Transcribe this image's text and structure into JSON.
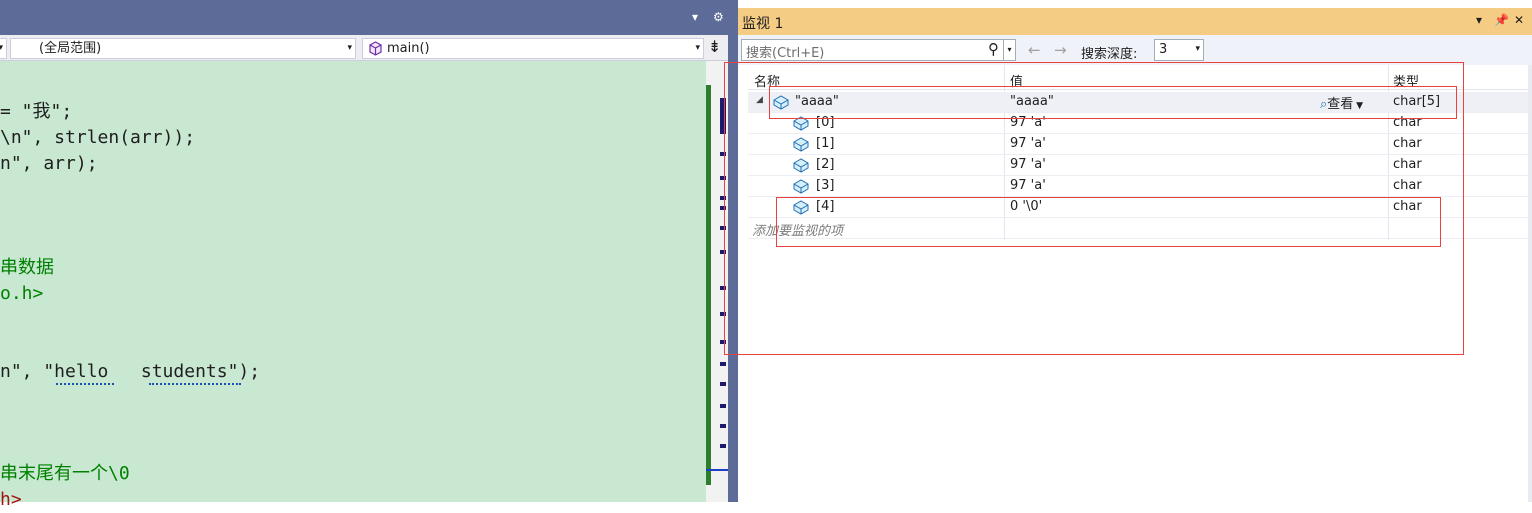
{
  "editor": {
    "nav": {
      "scope_combo": "(全局范围)",
      "function_combo": "main()"
    },
    "code_lines": [
      {
        "text": "= \"我\";",
        "style": "c-default"
      },
      {
        "text": "\\n\", strlen(arr));",
        "style": "c-default"
      },
      {
        "text": "n\", arr);",
        "style": "c-default"
      },
      {
        "text": "",
        "style": "c-default"
      },
      {
        "text": "",
        "style": "c-default"
      },
      {
        "text": "串数据",
        "style": "c-comment"
      },
      {
        "text": "o.h>",
        "style": "c-comment"
      },
      {
        "text": "",
        "style": "c-default"
      },
      {
        "text": "",
        "style": "c-default"
      },
      {
        "text": "n\", \"hello   students\");",
        "style": "c-default"
      },
      {
        "text": "",
        "style": "c-default"
      },
      {
        "text": "",
        "style": "c-default"
      },
      {
        "text": "串末尾有一个\\0",
        "style": "c-comment"
      },
      {
        "text": "h>",
        "style": "c-str"
      }
    ]
  },
  "watch": {
    "title": "监视 1",
    "search_placeholder": "搜索(Ctrl+E)",
    "depth_label": "搜索深度:",
    "depth_value": "3",
    "columns": {
      "name": "名称",
      "value": "值",
      "type": "类型"
    },
    "root": {
      "name": "\"aaaa\"",
      "value": "\"aaaa\"",
      "view": "查看",
      "type": "char[5]"
    },
    "children": [
      {
        "name": "[0]",
        "value": "97 'a'",
        "type": "char"
      },
      {
        "name": "[1]",
        "value": "97 'a'",
        "type": "char"
      },
      {
        "name": "[2]",
        "value": "97 'a'",
        "type": "char"
      },
      {
        "name": "[3]",
        "value": "97 'a'",
        "type": "char"
      },
      {
        "name": "[4]",
        "value": "0 '\\0'",
        "type": "char"
      }
    ],
    "add_item": "添加要监视的项"
  },
  "icons": [
    "dropdown-arrow-icon",
    "gear-icon",
    "cube-icon",
    "search-icon",
    "back-arrow-icon",
    "forward-arrow-icon",
    "pin-icon",
    "close-icon",
    "expand-triangle-icon",
    "view-icon",
    "split-icon"
  ],
  "colors": {
    "editor_bg": "#c9e8d2",
    "titlebar": "#5d6b99",
    "watch_title": "#f5cc84",
    "annotation": "#e8413e"
  }
}
